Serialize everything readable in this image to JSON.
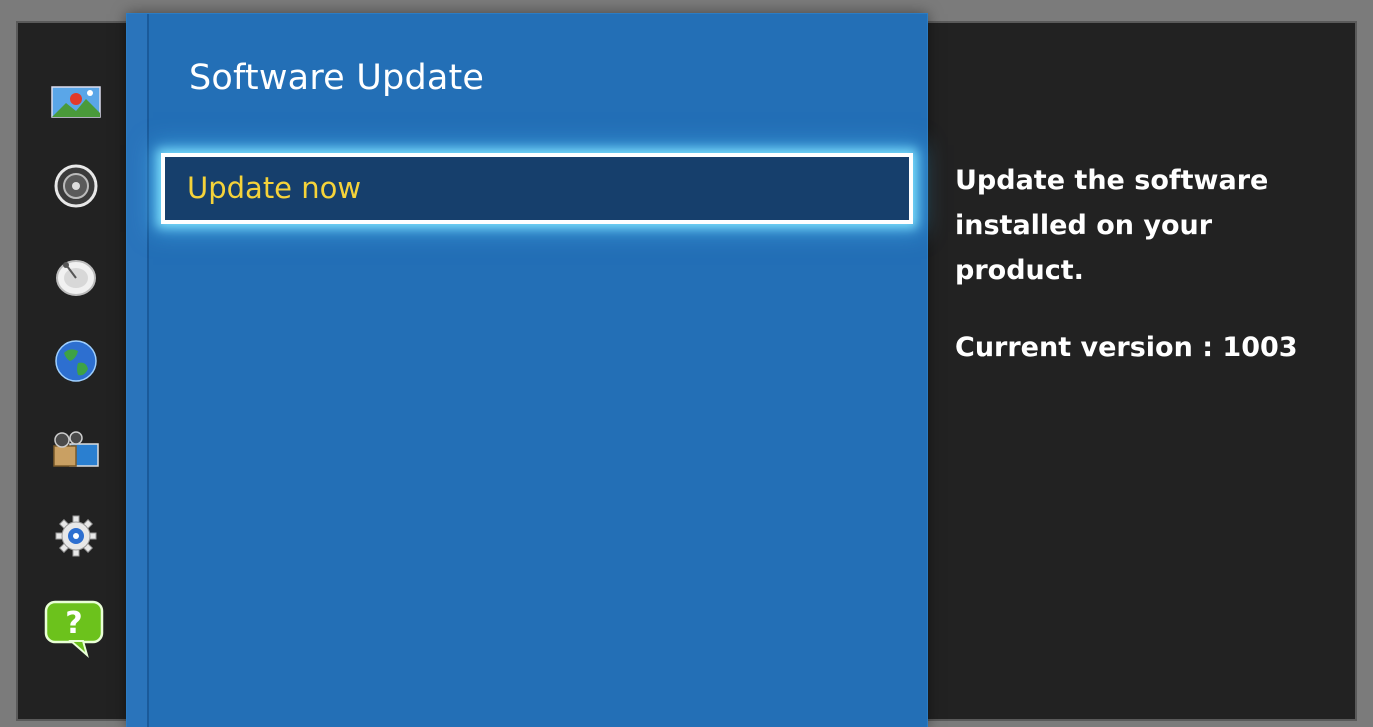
{
  "menu": {
    "title": "Software Update",
    "items": [
      {
        "label": "Update now",
        "selected": true
      }
    ]
  },
  "sidebar": {
    "items": [
      {
        "name": "picture",
        "icon": "picture-icon"
      },
      {
        "name": "sound",
        "icon": "speaker-icon"
      },
      {
        "name": "broadcast",
        "icon": "satellite-dish-icon"
      },
      {
        "name": "network",
        "icon": "globe-icon"
      },
      {
        "name": "smart-features",
        "icon": "media-icon"
      },
      {
        "name": "system",
        "icon": "gear-icon"
      },
      {
        "name": "support",
        "icon": "help-icon",
        "active": true
      }
    ]
  },
  "info": {
    "description": "Update the software installed on your product.",
    "current_version": "Current version : 1003"
  },
  "colors": {
    "panel_bg": "#236fb6",
    "selected_item_bg": "#163f6c",
    "selected_text": "#f5d33a",
    "screen_bg": "#222222",
    "frame_bg": "#7b7b7b",
    "help_green": "#6cc21c"
  }
}
